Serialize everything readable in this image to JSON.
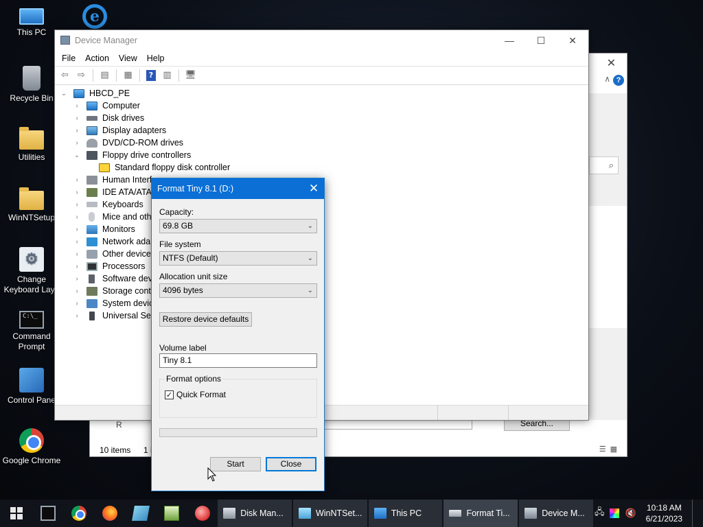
{
  "desktop": {
    "icons": [
      {
        "label": "This PC",
        "icon": "this-pc-icon"
      },
      {
        "label": "",
        "icon": "internet-explorer-icon"
      },
      {
        "label": "Recycle Bin",
        "icon": "recycle-bin-icon"
      },
      {
        "label": "Utilities",
        "icon": "folder-icon"
      },
      {
        "label": "WinNTSetup",
        "icon": "folder-icon"
      },
      {
        "label": "Change Keyboard Layout",
        "label_line1": "Change",
        "label_line2": "Keyboard Layo",
        "icon": "keyboard-settings-icon"
      },
      {
        "label_line1": "Command",
        "label_line2": "Prompt",
        "icon": "command-prompt-icon"
      },
      {
        "label": "Control Panel",
        "display": "Control Pane",
        "icon": "control-panel-icon"
      },
      {
        "label": "Google Chrome",
        "icon": "chrome-icon"
      }
    ]
  },
  "background_window": {
    "search_button": "Search...",
    "status_count": "10 items",
    "status_fragment": "1 i",
    "row_fragment": "R"
  },
  "device_manager": {
    "title": "Device Manager",
    "menu": [
      "File",
      "Action",
      "View",
      "Help"
    ],
    "tree": {
      "root": "HBCD_PE",
      "nodes": [
        {
          "label": "Computer",
          "expanded": false
        },
        {
          "label": "Disk drives",
          "expanded": false
        },
        {
          "label": "Display adapters",
          "expanded": false
        },
        {
          "label": "DVD/CD-ROM drives",
          "expanded": false
        },
        {
          "label": "Floppy drive controllers",
          "expanded": true
        },
        {
          "label": "Standard floppy disk controller",
          "child": true
        },
        {
          "label": "Human Interface Devices",
          "display": "Human Interfa",
          "expanded": false
        },
        {
          "label": "IDE ATA/ATAPI controllers",
          "display": "IDE ATA/ATAPI",
          "expanded": false
        },
        {
          "label": "Keyboards",
          "expanded": false
        },
        {
          "label": "Mice and other pointing devices",
          "display": "Mice and othe",
          "expanded": false
        },
        {
          "label": "Monitors",
          "expanded": false
        },
        {
          "label": "Network adapters",
          "display": "Network adapt",
          "expanded": false
        },
        {
          "label": "Other devices",
          "expanded": false
        },
        {
          "label": "Processors",
          "expanded": false
        },
        {
          "label": "Software devices",
          "display": "Software devic",
          "expanded": false
        },
        {
          "label": "Storage controllers",
          "display": "Storage contro",
          "expanded": false
        },
        {
          "label": "System devices",
          "display": "System devices",
          "expanded": false
        },
        {
          "label": "Universal Serial Bus controllers",
          "display": "Universal Seria",
          "expanded": false
        }
      ]
    }
  },
  "format_dialog": {
    "title": "Format Tiny 8.1 (D:)",
    "capacity_label": "Capacity:",
    "capacity_value": "69.8 GB",
    "filesystem_label": "File system",
    "filesystem_value": "NTFS (Default)",
    "allocation_label": "Allocation unit size",
    "allocation_value": "4096 bytes",
    "restore_button": "Restore device defaults",
    "volume_label_label": "Volume label",
    "volume_label_value": "Tiny 8.1",
    "format_options_label": "Format options",
    "quick_format_label": "Quick Format",
    "quick_format_checked": true,
    "progress": 0,
    "start_button": "Start",
    "close_button": "Close"
  },
  "taskbar": {
    "pinned": [
      "command-prompt-icon",
      "chrome-icon",
      "firefox-icon",
      "notepad-icon",
      "notepad-plus-icon",
      "network-globe-icon"
    ],
    "tasks": [
      {
        "label": "Disk Man...",
        "icon": "disk-management-icon",
        "active": false
      },
      {
        "label": "WinNTSet...",
        "icon": "winntsetup-icon",
        "active": false
      },
      {
        "label": "This PC",
        "icon": "this-pc-icon",
        "active": false
      },
      {
        "label": "Format Ti...",
        "icon": "format-drive-icon",
        "active": true
      },
      {
        "label": "Device M...",
        "icon": "device-manager-icon",
        "active": false
      }
    ],
    "clock_time": "10:18 AM",
    "clock_date": "6/21/2023"
  }
}
